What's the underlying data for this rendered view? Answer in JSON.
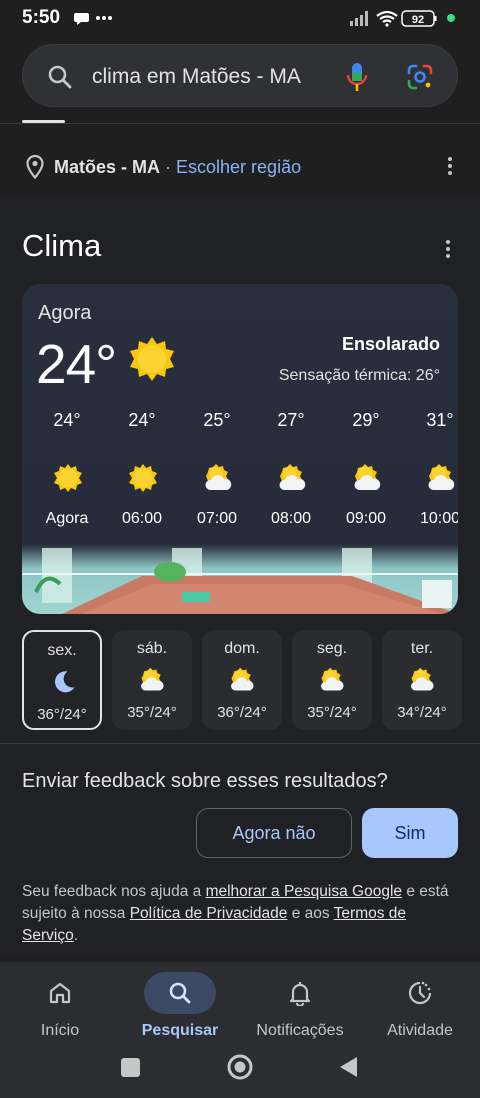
{
  "status_bar": {
    "time": "5:50",
    "battery": "92"
  },
  "search": {
    "query": "clima em Matões - MA"
  },
  "location": {
    "name": "Matões - MA",
    "separator": " · ",
    "link": "Escolher região"
  },
  "weather": {
    "title": "Clima",
    "now_label": "Agora",
    "temperature": "24°",
    "condition": "Ensolarado",
    "feels_like": "Sensação térmica: 26°",
    "hourly": [
      {
        "temp": "24°",
        "time": "Agora",
        "icon": "sun-icon"
      },
      {
        "temp": "24°",
        "time": "06:00",
        "icon": "sun-icon"
      },
      {
        "temp": "25°",
        "time": "07:00",
        "icon": "sun-cloud-icon"
      },
      {
        "temp": "27°",
        "time": "08:00",
        "icon": "sun-cloud-icon"
      },
      {
        "temp": "29°",
        "time": "09:00",
        "icon": "sun-cloud-icon"
      },
      {
        "temp": "31°",
        "time": "10:00",
        "icon": "sun-cloud-icon"
      }
    ],
    "daily": [
      {
        "day": "sex.",
        "range": "36°/24°",
        "icon": "moon-icon",
        "selected": true
      },
      {
        "day": "sáb.",
        "range": "35°/24°",
        "icon": "sun-cloud-icon"
      },
      {
        "day": "dom.",
        "range": "36°/24°",
        "icon": "sun-cloud-icon"
      },
      {
        "day": "seg.",
        "range": "35°/24°",
        "icon": "sun-cloud-icon"
      },
      {
        "day": "ter.",
        "range": "34°/24°",
        "icon": "sun-cloud-icon"
      }
    ]
  },
  "feedback": {
    "question": "Enviar feedback sobre esses resultados?",
    "no_label": "Agora não",
    "yes_label": "Sim",
    "note_prefix": "Seu feedback nos ajuda a ",
    "note_link1": "melhorar a Pesquisa Google",
    "note_mid1": " e está sujeito à nossa ",
    "note_link2": "Política de Privacidade",
    "note_mid2": " e aos ",
    "note_link3": "Termos de Serviço",
    "note_end": "."
  },
  "bottom_nav": [
    {
      "label": "Início",
      "icon": "home-icon"
    },
    {
      "label": "Pesquisar",
      "icon": "search-icon",
      "active": true
    },
    {
      "label": "Notificações",
      "icon": "bell-icon"
    },
    {
      "label": "Atividade",
      "icon": "activity-icon"
    }
  ],
  "colors": {
    "background": "#1f1f1f",
    "accent": "#a8c7fa",
    "link": "#8ab4f8",
    "sun": "#f9c80e"
  }
}
